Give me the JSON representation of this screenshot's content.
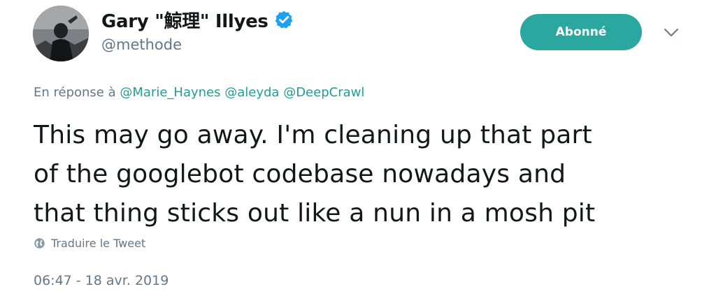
{
  "author": {
    "display_name": "Gary \"鯨理\" Illyes",
    "handle": "@methode",
    "avatar_icon": "profile-photo",
    "verified_icon": "verified-badge-icon"
  },
  "actions": {
    "follow_label": "Abonné",
    "more_icon": "chevron-down-icon"
  },
  "reply": {
    "prefix": "En réponse à",
    "mentions": [
      "@Marie_Haynes",
      "@aleyda",
      "@DeepCrawl"
    ]
  },
  "tweet": {
    "text_lines": [
      "This may go away. I'm cleaning up that part",
      "of the googlebot codebase nowadays and",
      "that thing sticks out like a nun in a mosh pit"
    ]
  },
  "translate": {
    "label": "Traduire le Tweet",
    "icon": "globe-icon"
  },
  "meta": {
    "timestamp": "06:47 - 18 avr. 2019"
  },
  "colors": {
    "accent": "#2aa8a0",
    "mention": "#1f9d96",
    "secondary_text": "#657786",
    "verified": "#1da1f2"
  }
}
